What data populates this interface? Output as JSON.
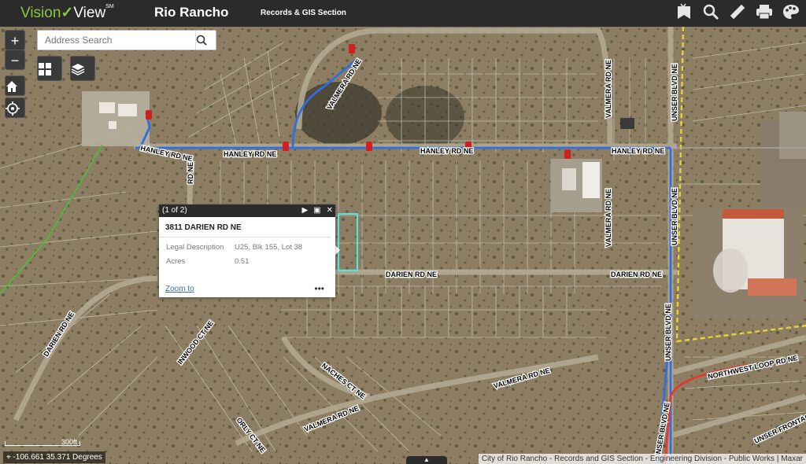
{
  "header": {
    "logo_part1": "Vision",
    "logo_part2": "View",
    "logo_sm": "SM",
    "city": "Rio Rancho",
    "section": "Records & GIS Section",
    "tools": [
      {
        "name": "bookmark-icon",
        "glyph": "🔖"
      },
      {
        "name": "identify-icon",
        "glyph": "🔍"
      },
      {
        "name": "measure-icon",
        "glyph": "📏"
      },
      {
        "name": "print-icon",
        "glyph": "🖨"
      },
      {
        "name": "basemap-palette-icon",
        "glyph": "🎨"
      }
    ]
  },
  "search": {
    "placeholder": "Address Search"
  },
  "popup": {
    "counter": "(1 of 2)",
    "title": "3811 DARIEN RD NE",
    "fields": [
      {
        "label": "Legal Description",
        "value": "U25, Blk 155, Lot 38"
      },
      {
        "label": "Acres",
        "value": "0.51"
      }
    ],
    "zoom_link": "Zoom to",
    "more": "•••"
  },
  "roads": [
    "HANLEY RD NE",
    "HANLEY RD NE",
    "HANLEY RD NE",
    "HANLEY RD NE",
    "VALMERA RD NE",
    "VALMERA RD NE",
    "VALMERA RD NE",
    "VALMERA RD NE",
    "VALMERA RD NE",
    "UNSER BLVD NE",
    "UNSER BLVD NE",
    "UNSER BLVD NE",
    "UNSER BLVD NE",
    "DARIEN RD NE",
    "DARIEN RD NE",
    "DARIEN RD NE",
    "INWOOD CT NE",
    "NACHES CT NE",
    "ORLY CT NE",
    "NORTHWEST LOOP RD NE",
    "UNSER FRONTAGE",
    "RD NE"
  ],
  "scale_label": "300ft",
  "coords": "-106.661 35.371 Degrees",
  "attribution": "City of Rio Rancho - Records and GIS Section - Engineering Division - Public Works | Maxar",
  "colors": {
    "header": "#2b2b2b",
    "accent": "#8cc63f",
    "waterline": "#2f6fe0",
    "selection": "#4ee6e6"
  }
}
